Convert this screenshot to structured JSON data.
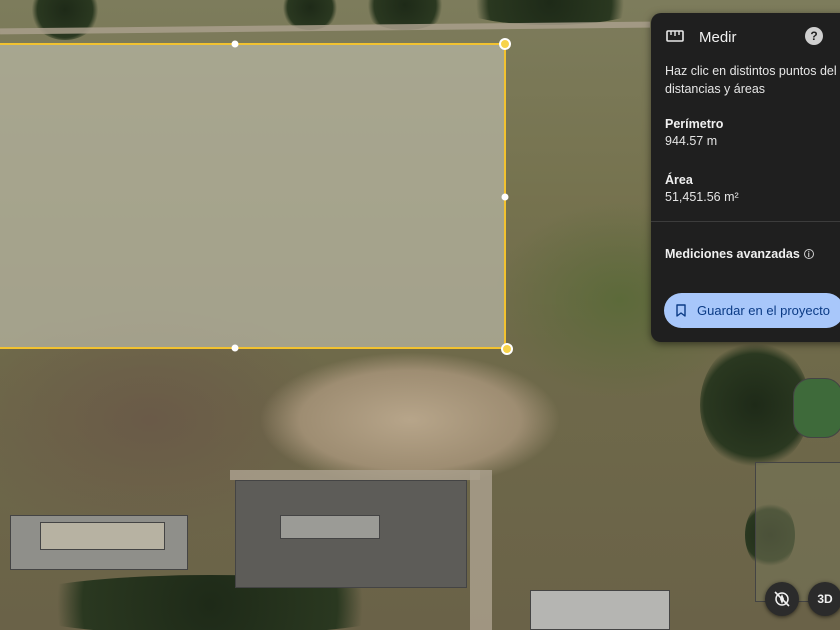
{
  "panel": {
    "title": "Medir",
    "help_symbol": "?",
    "instructions_line1": "Haz clic en distintos puntos del m",
    "instructions_line2": "distancias y áreas",
    "perimeter_label": "Perímetro",
    "perimeter_value": "944.57 m",
    "area_label": "Área",
    "area_value": "51,451.56 m²",
    "advanced_label": "Mediciones avanzadas",
    "info_symbol": "i",
    "save_label": "Guardar en el proyecto"
  },
  "controls": {
    "threed_label": "3D"
  },
  "icons": {
    "ruler": "ruler-icon",
    "help": "help-icon",
    "info": "info-icon",
    "bookmark": "bookmark-icon",
    "compass_off": "compass-off-icon"
  },
  "colors": {
    "polygon_outline": "#f2c230",
    "panel_background": "#1f1f1f",
    "save_button": "#a8c7fa"
  }
}
